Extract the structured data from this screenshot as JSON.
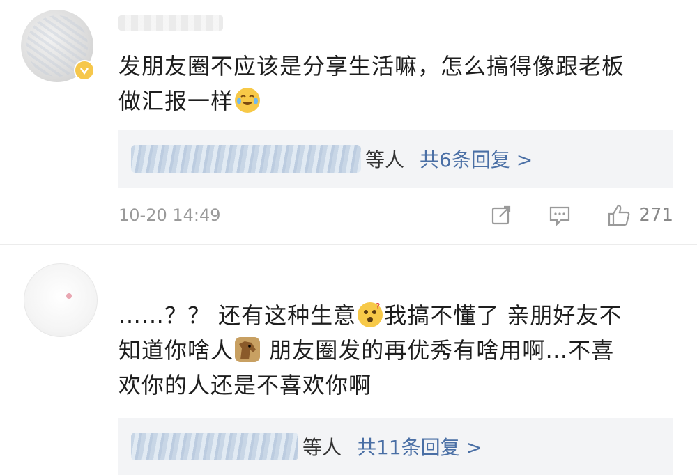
{
  "comments": [
    {
      "text_line1": "发朋友圈不应该是分享生活嘛，怎么搞得像跟老板",
      "text_line2": "做汇报一样",
      "replies": {
        "others_label": "等人",
        "count_label": "共6条回复 >"
      },
      "timestamp": "10-20 14:49",
      "likes": "271",
      "icons": [
        "share-icon",
        "comment-icon",
        "thumbs-up-icon"
      ]
    },
    {
      "text_line1_part1": "……？？ 还有这种生意",
      "text_line1_part2": "我搞不懂了   亲朋好友不",
      "text_line2_part1": "知道你啥人",
      "text_line2_part2": "  朋友圈发的再优秀有啥用啊…不喜",
      "text_line3": "欢你的人还是不喜欢你啊",
      "replies": {
        "others_label": "等人",
        "count_label": "共11条回复 >"
      }
    }
  ],
  "colors": {
    "reply_link": "#4a6fa5",
    "reply_bg": "#f3f4f6",
    "meta_text": "#9a9a9a",
    "emoji": "#f7c948"
  }
}
